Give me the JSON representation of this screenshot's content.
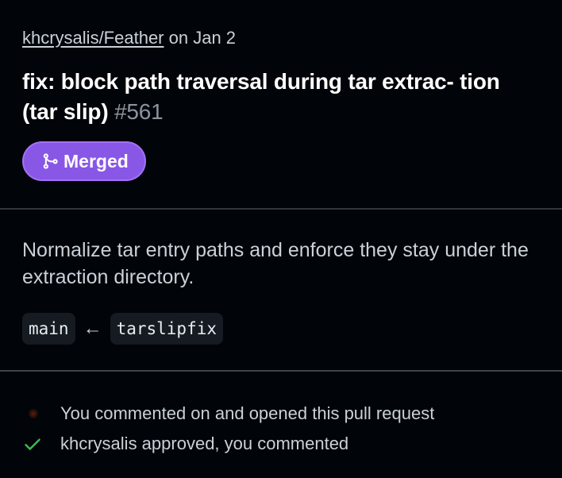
{
  "header": {
    "repo": "khcrysalis/Feather",
    "date_text": "on Jan 2"
  },
  "pr": {
    "title": "fix: block path traversal during tar extrac- tion (tar slip)",
    "number": "#561",
    "status": "Merged",
    "status_color": "#8957e5"
  },
  "description": "Normalize tar entry paths and enforce they stay under the extraction directory.",
  "branches": {
    "base": "main",
    "arrow": "←",
    "head": "tarslipfix"
  },
  "activity": [
    {
      "icon": "avatar-dot-icon",
      "text": "You commented on and opened this pull request"
    },
    {
      "icon": "check-icon",
      "text": "khcrysalis approved, you commented",
      "color": "#3fb950"
    }
  ]
}
